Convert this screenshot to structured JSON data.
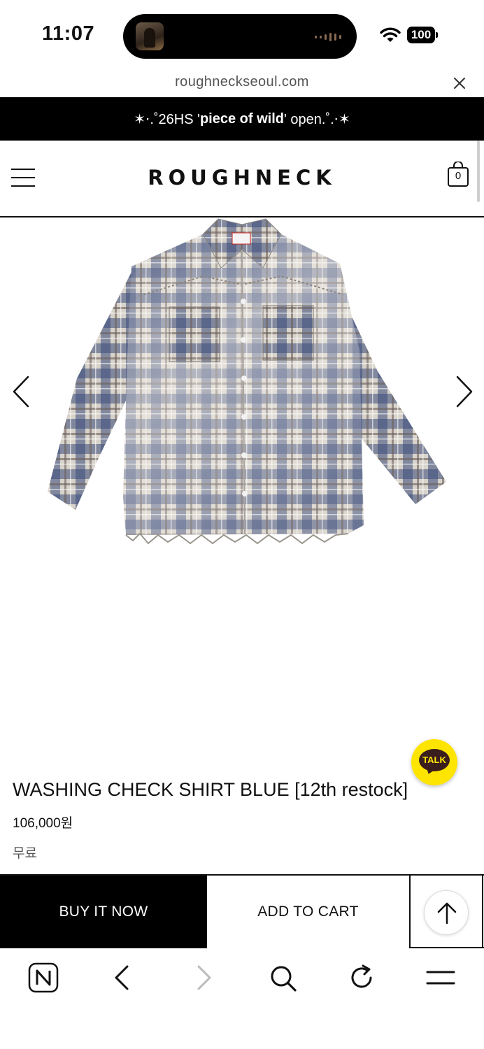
{
  "status_bar": {
    "time": "11:07",
    "battery": "100"
  },
  "browser": {
    "url": "roughneckseoul.com"
  },
  "announcement": {
    "prefix": "✶⋅.˚26HS '",
    "highlight": "piece of wild",
    "suffix": "' open.˚.⋅✶"
  },
  "header": {
    "logo": "ROUGHNECK",
    "cart_count": "0"
  },
  "chat": {
    "label": "TALK"
  },
  "product": {
    "title": "WASHING CHECK SHIRT BLUE [12th restock]",
    "price": "106,000원",
    "shipping": "무료"
  },
  "actions": {
    "buy_now": "BUY IT NOW",
    "add_to_cart": "ADD TO CART"
  },
  "colors": {
    "accent": "#000000",
    "kakao": "#FDE500",
    "shirt_navy": "#2d3a66",
    "shirt_light": "#d9d4cb"
  }
}
